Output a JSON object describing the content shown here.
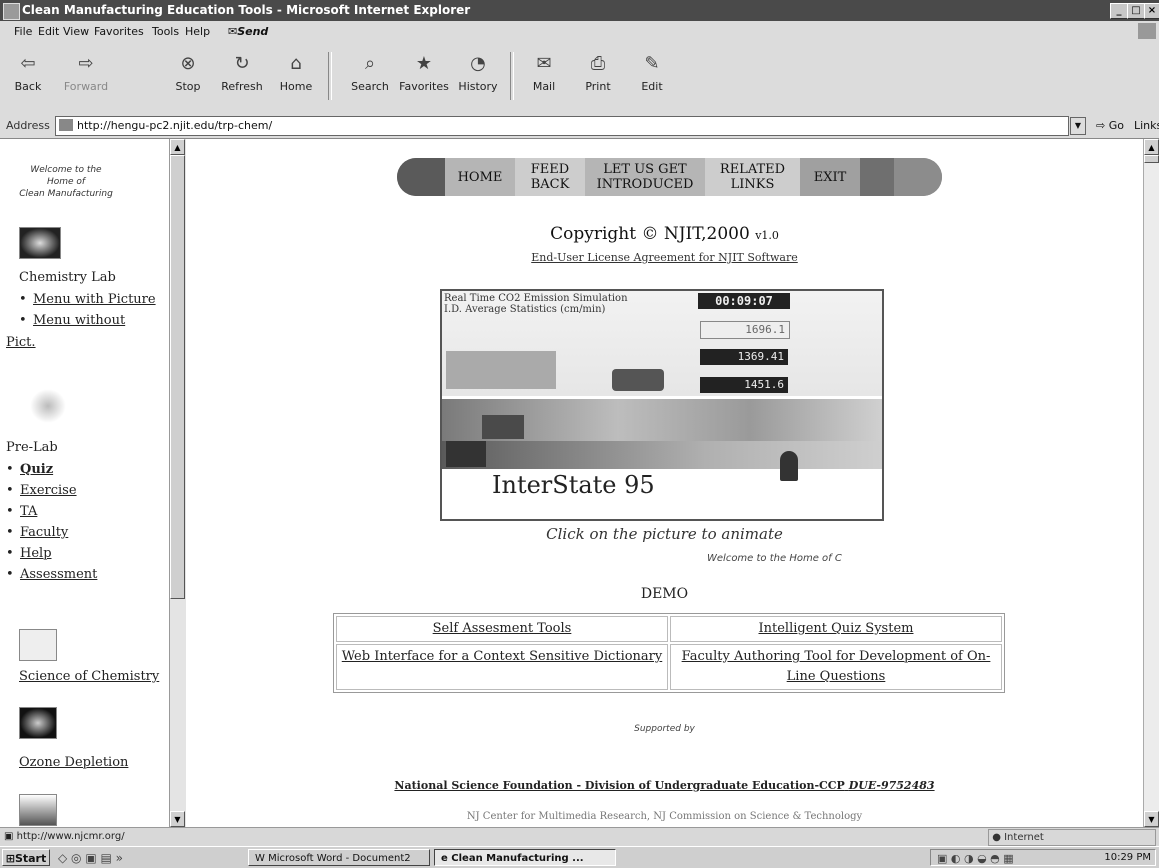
{
  "window": {
    "title": "Clean Manufacturing Education Tools - Microsoft Internet Explorer"
  },
  "menu": {
    "items": [
      "File",
      "Edit",
      "View",
      "Favorites",
      "Tools",
      "Help"
    ],
    "send": "Send"
  },
  "toolbar": {
    "back": "Back",
    "forward": "Forward",
    "stop": "Stop",
    "refresh": "Refresh",
    "home": "Home",
    "search": "Search",
    "favorites": "Favorites",
    "history": "History",
    "mail": "Mail",
    "print": "Print",
    "edit": "Edit"
  },
  "address": {
    "label": "Address",
    "url": "http://hengu-pc2.njit.edu/trp-chem/",
    "go": "Go",
    "links": "Links"
  },
  "left": {
    "welcome": [
      "Welcome to the",
      "Home of",
      "Clean Manufacturing"
    ],
    "chem_lab": "Chemistry Lab",
    "chem_items": [
      "Menu with Picture",
      "Menu without"
    ],
    "chem_pict": "Pict.",
    "prelab": "Pre-Lab",
    "prelab_items": [
      "Quiz",
      "Exercise",
      "TA",
      "Faculty",
      "Help",
      "Assessment"
    ],
    "science": "Science of Chemistry",
    "ozone": "Ozone Depletion"
  },
  "nav": {
    "home": "HOME",
    "feedback_1": "FEED",
    "feedback_2": "BACK",
    "intro_1": "LET US GET",
    "intro_2": "INTRODUCED",
    "related_1": "RELATED",
    "related_2": "LINKS",
    "exit": "EXIT"
  },
  "main": {
    "copyright": "Copyright © NJIT,2000",
    "version": "v1.0",
    "eula": "End-User License Agreement for NJIT Software",
    "anim": {
      "sim_title": "Real Time CO2 Emission Simulation",
      "sim_sub": "I.D. Average Statistics (cm/min)",
      "clock": "00:09:07",
      "reading1": "1696.1",
      "reading2": "1369.41",
      "reading3": "1451.6",
      "road_label": "InterState 95"
    },
    "caption": "Click on the picture to animate",
    "welcome_marquee": "Welcome to the Home of C",
    "demo": "DEMO",
    "demo_links": [
      "Self Assesment Tools",
      "Intelligent Quiz System",
      "Web Interface for a  Context Sensitive Dictionary",
      "Faculty Authoring Tool for Development of On-Line Questions"
    ],
    "supported_by": "Supported by",
    "nsf": "National Science Foundation - Division of Undergraduate Education-CCP",
    "nsf_grant": "DUE-9752483",
    "cut_line": "NJ Center for Multimedia Research, NJ Commission on Science & Technology"
  },
  "status": {
    "url": "http://www.njcmr.org/",
    "zone": "Internet"
  },
  "taskbar": {
    "start": "Start",
    "task1": "Microsoft Word - Document2",
    "task2": "Clean Manufacturing ...",
    "time": "10:29 PM"
  }
}
